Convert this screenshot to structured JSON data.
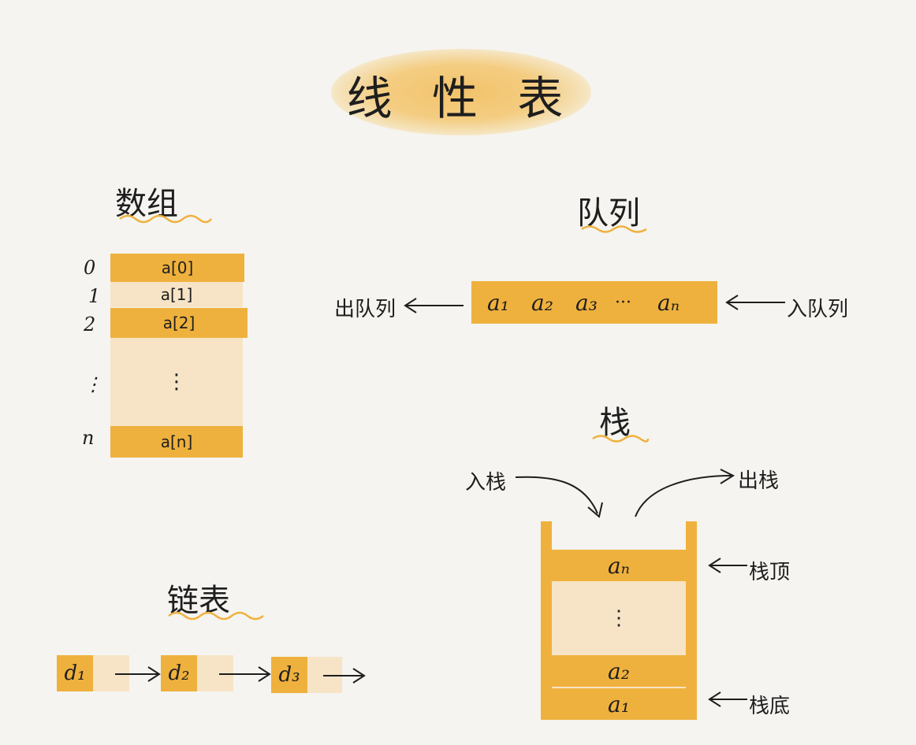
{
  "title": "线 性 表",
  "array": {
    "title": "数组",
    "indices": [
      "0",
      "1",
      "2",
      "⋮",
      "n"
    ],
    "cells": [
      "a[0]",
      "a[1]",
      "a[2]",
      "⋮",
      "a[n]"
    ]
  },
  "queue": {
    "title": "队列",
    "items": [
      "a₁",
      "a₂",
      "a₃",
      "···",
      "aₙ"
    ],
    "dequeue_label": "出队列",
    "enqueue_label": "入队列"
  },
  "stack": {
    "title": "栈",
    "push_label": "入栈",
    "pop_label": "出栈",
    "top_item": "aₙ",
    "middle": "⋮",
    "second_item": "a₂",
    "bottom_item": "a₁",
    "top_label": "栈顶",
    "bottom_label": "栈底"
  },
  "linked_list": {
    "title": "链表",
    "nodes": [
      "d₁",
      "d₂",
      "d₃"
    ]
  },
  "colors": {
    "accent": "#efb13d",
    "light": "#f7e4c6",
    "background": "#f5f4f0",
    "ink": "#1e1e1e"
  }
}
